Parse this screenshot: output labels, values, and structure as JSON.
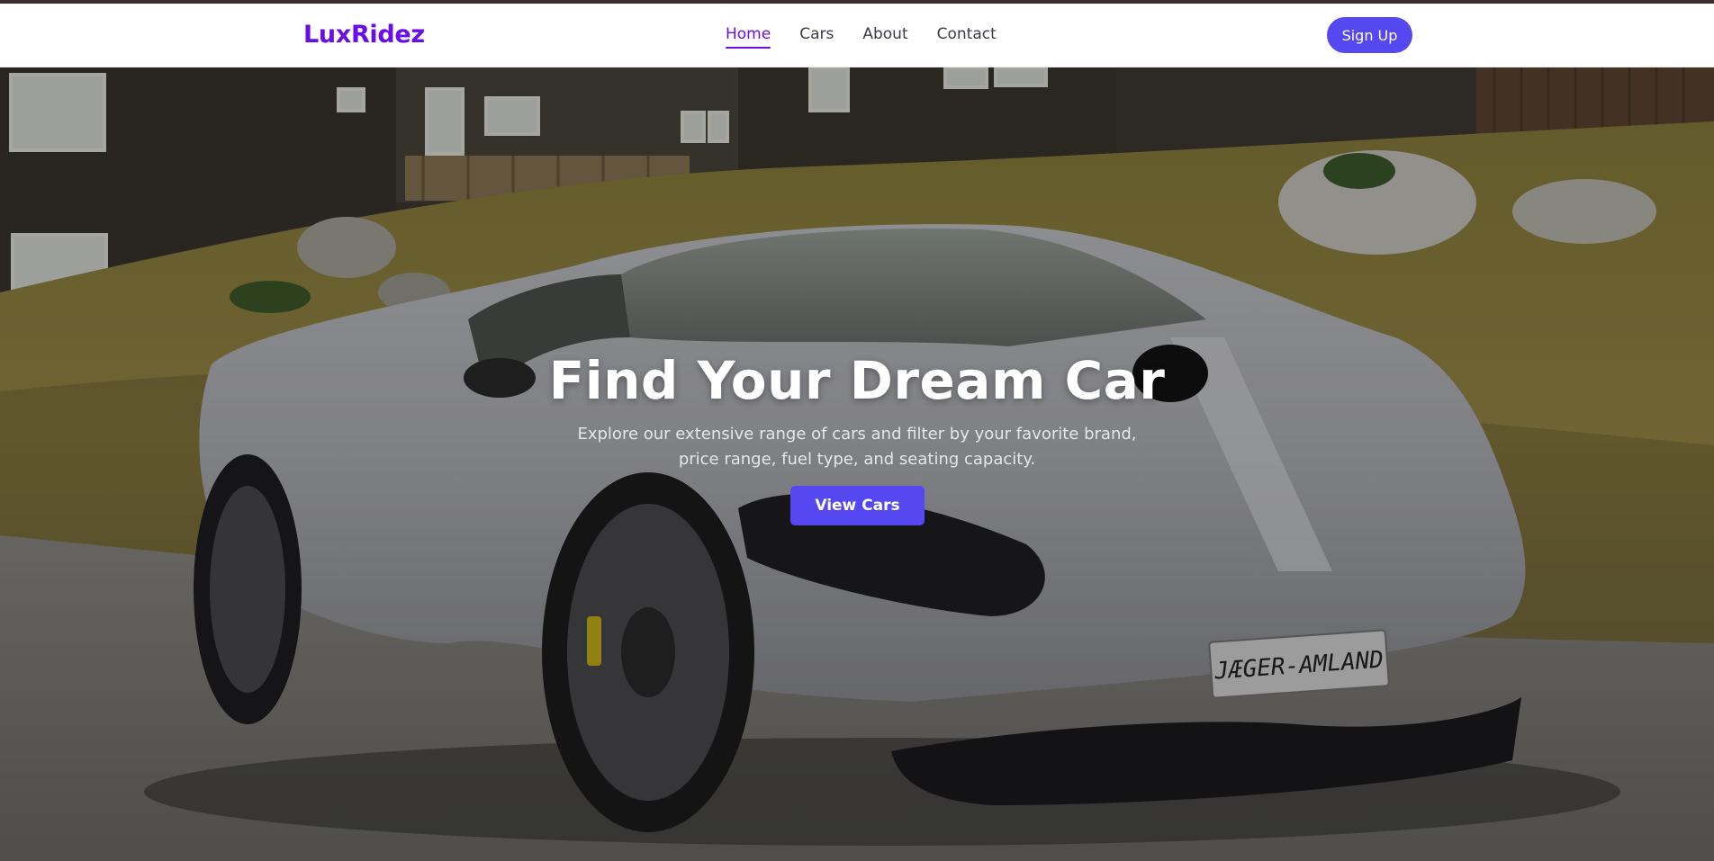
{
  "nav": {
    "brand": "LuxRidez",
    "links": [
      {
        "label": "Home",
        "active": true
      },
      {
        "label": "Cars",
        "active": false
      },
      {
        "label": "About",
        "active": false
      },
      {
        "label": "Contact",
        "active": false
      }
    ],
    "signup_label": "Sign Up"
  },
  "hero": {
    "title": "Find Your Dream Car",
    "subtitle": "Explore our extensive range of cars and filter by your favorite brand, price range, fuel type, and seating capacity.",
    "cta_label": "View Cars",
    "plate_text": "JÆGER-AMLAND"
  },
  "colors": {
    "brand": "#6a0de8",
    "accent": "#5548f0",
    "nav_text": "#3b3b4a",
    "top_strip": "#3a2d2d"
  }
}
